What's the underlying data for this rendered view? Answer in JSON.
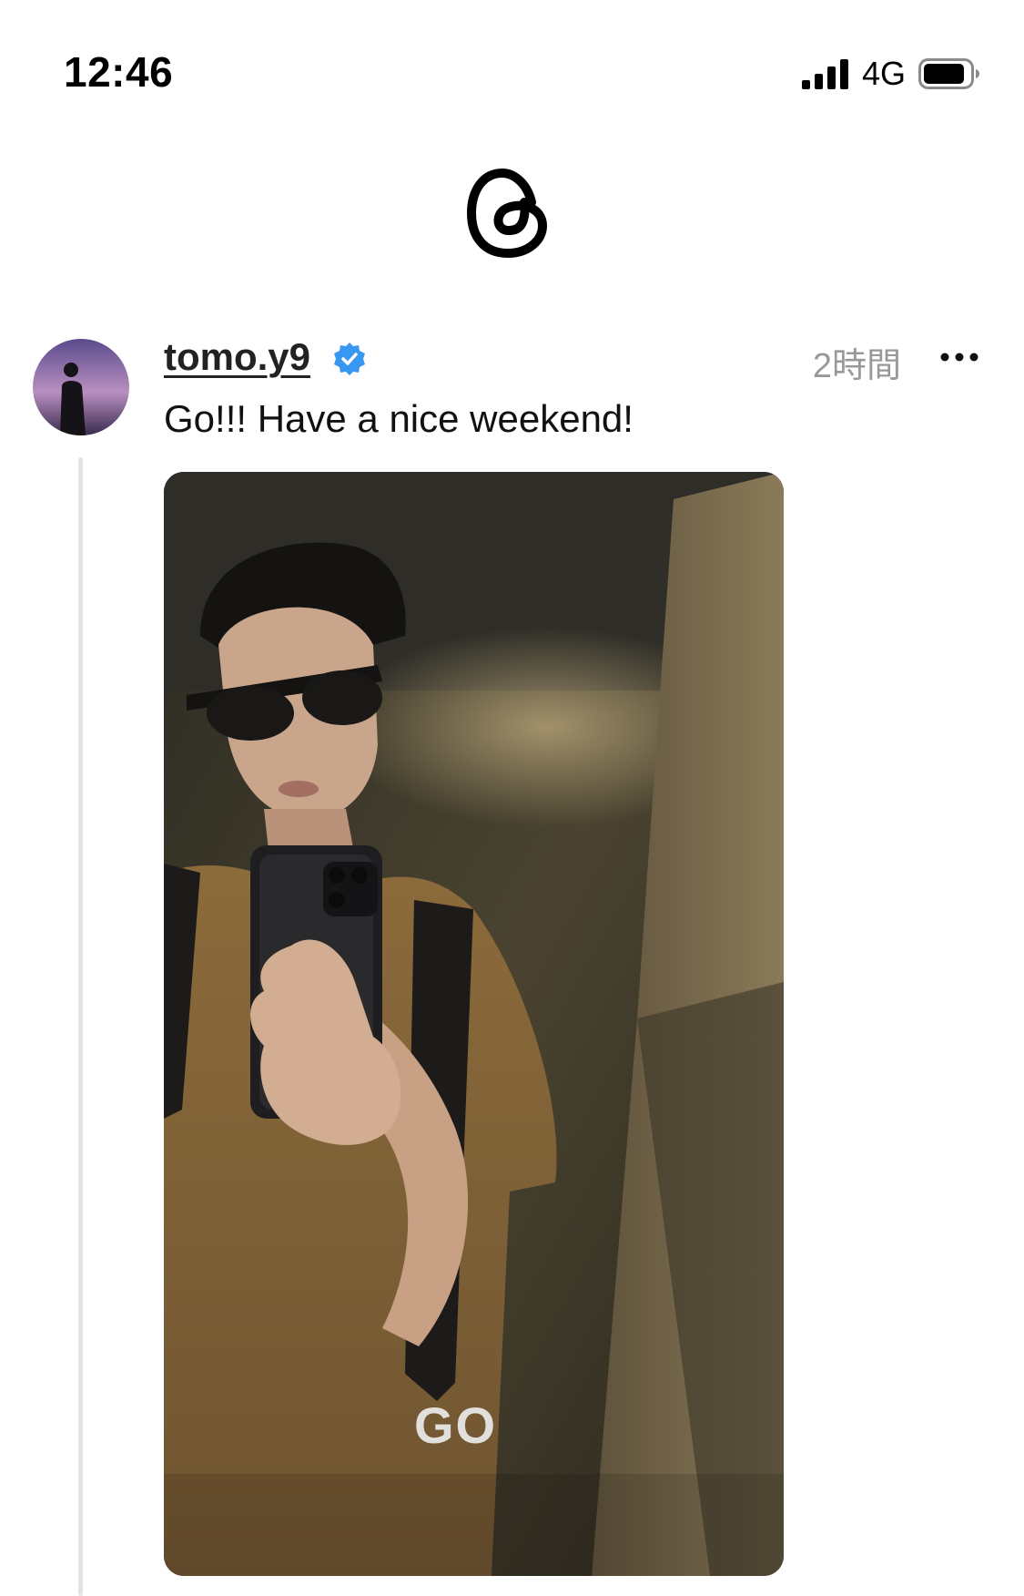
{
  "status_bar": {
    "time": "12:46",
    "network": "4G",
    "signal_icon": "cellular-signal-icon",
    "battery_icon": "battery-icon"
  },
  "header": {
    "logo_icon": "threads-logo-icon"
  },
  "post": {
    "username": "tomo.y9",
    "verified_icon": "verified-badge-icon",
    "timestamp": "2時間",
    "more_icon": "more-options-icon",
    "text": "Go!!! Have a nice weekend!",
    "image_caption": "GO"
  },
  "colors": {
    "verified": "#3897f0",
    "timestamp": "#999999",
    "thread_line": "#e4e4e4",
    "photo_shirt": "#8a6a3a"
  }
}
